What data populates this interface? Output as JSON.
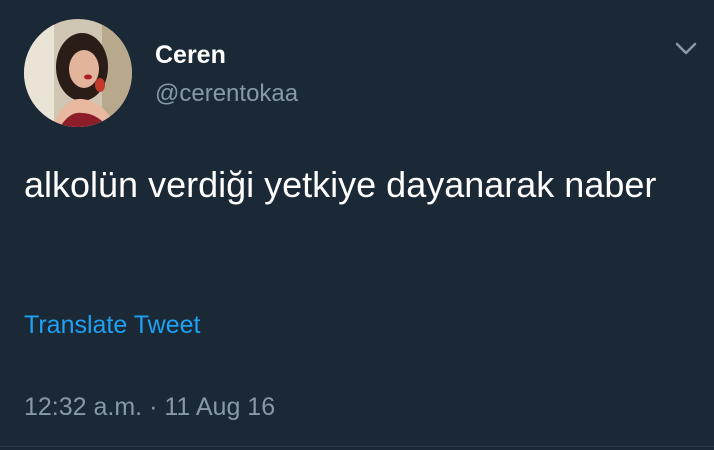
{
  "user": {
    "display_name": "Ceren",
    "handle": "@cerentokaa",
    "avatar_icon": "profile-photo"
  },
  "tweet": {
    "text": "alkolün verdiği yetkiye dayanarak naber",
    "translate_label": "Translate Tweet",
    "timestamp": "12:32 a.m. · 11 Aug 16"
  },
  "menu": {
    "icon": "chevron-down-icon"
  },
  "colors": {
    "background": "#1b2836",
    "primary_text": "#ffffff",
    "secondary_text": "#8899a6",
    "link": "#1da1f2"
  }
}
